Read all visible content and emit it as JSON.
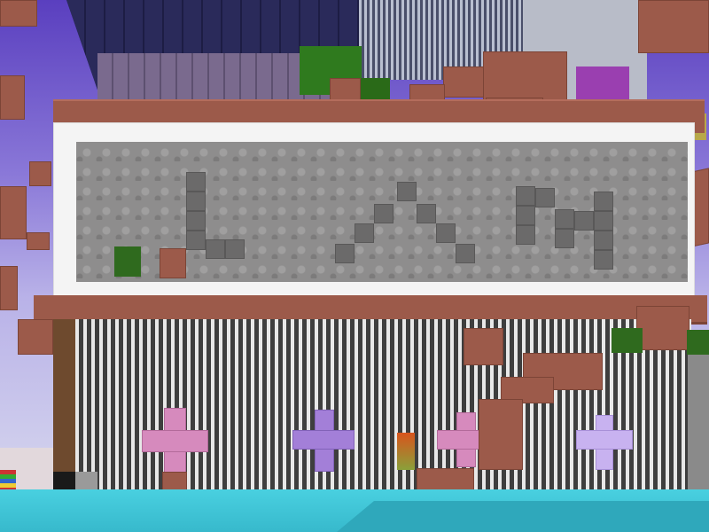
{
  "scene": {
    "type": "voxel-game-view",
    "sign_text": "L^M",
    "colors": {
      "sky_top": "#5a3fbf",
      "water": "#49d0e0",
      "brick": "#9c5a4a",
      "sign_stone": "#8e8d8d",
      "frame": "#f4f4f4",
      "pink_plus": "#d68abd",
      "violet_plus": "#a37fd8",
      "lavender_plus": "#c8b2f0"
    },
    "plus_decorations": [
      "pink-plus",
      "violet-plus",
      "pink-plus",
      "lavender-plus"
    ]
  }
}
